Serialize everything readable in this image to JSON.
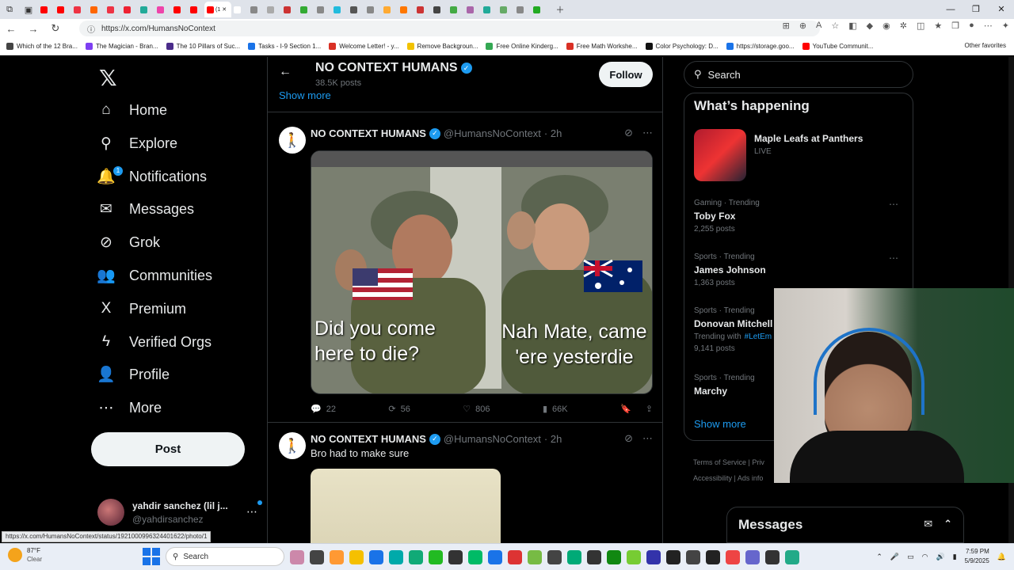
{
  "browser": {
    "active_tab_label": "(1",
    "tab_count_visible": 30,
    "url": "https://x.com/HumansNoContext",
    "status_url": "https://x.com/HumansNoContext/status/1921000996324401622/photo/1",
    "window_controls": [
      "—",
      "❐",
      "✕"
    ],
    "bookmarks": [
      {
        "label": "Which of the 12 Bra...",
        "color": "#444444"
      },
      {
        "label": "The Magician - Bran...",
        "color": "#7e3ff2"
      },
      {
        "label": "The 10 Pillars of Suc...",
        "color": "#4b2c8a"
      },
      {
        "label": "Tasks - I-9 Section 1...",
        "color": "#1a73e8"
      },
      {
        "label": "Welcome Letter! - y...",
        "color": "#d93025"
      },
      {
        "label": "Remove Backgroun...",
        "color": "#f2c200"
      },
      {
        "label": "Free Online Kinderg...",
        "color": "#34a853"
      },
      {
        "label": "Free Math Workshe...",
        "color": "#d93025"
      },
      {
        "label": "Color Psychology: D...",
        "color": "#111111"
      },
      {
        "label": "https://storage.goo...",
        "color": "#1a73e8"
      },
      {
        "label": "YouTube Communit...",
        "color": "#ff0000"
      }
    ],
    "other_favorites": "Other favorites"
  },
  "nav": {
    "items": [
      {
        "label": "Home",
        "icon": "⌂"
      },
      {
        "label": "Explore",
        "icon": "⚲"
      },
      {
        "label": "Notifications",
        "icon": "🔔",
        "badge": "1"
      },
      {
        "label": "Messages",
        "icon": "✉"
      },
      {
        "label": "Grok",
        "icon": "⊘"
      },
      {
        "label": "Communities",
        "icon": "👥"
      },
      {
        "label": "Premium",
        "icon": "X"
      },
      {
        "label": "Verified Orgs",
        "icon": "ϟ"
      },
      {
        "label": "Profile",
        "icon": "👤"
      },
      {
        "label": "More",
        "icon": "⋯"
      }
    ],
    "post_label": "Post",
    "account": {
      "name": "yahdir sanchez (lil j...",
      "handle": "@yahdirsanchez"
    }
  },
  "profile_header": {
    "title": "NO CONTEXT HUMANS",
    "posts": "38.5K posts",
    "show_more": "Show more",
    "follow_label": "Follow"
  },
  "tweets": [
    {
      "name": "NO CONTEXT HUMANS",
      "handle": "@HumansNoContext",
      "time": "· 2h",
      "text": "",
      "caption_left": "Did you come here to die?",
      "caption_right": "Nah Mate, came 'ere yesterdie",
      "replies": "22",
      "reposts": "56",
      "likes": "806",
      "views": "66K"
    },
    {
      "name": "NO CONTEXT HUMANS",
      "handle": "@HumansNoContext",
      "time": "· 2h",
      "text": "Bro had to make sure"
    }
  ],
  "right": {
    "search_placeholder": "Search",
    "trends_title": "What’s happening",
    "event": {
      "name": "Maple Leafs at Panthers",
      "status": "LIVE"
    },
    "trends": [
      {
        "category": "Gaming · Trending",
        "name": "Toby Fox",
        "posts": "2,255 posts"
      },
      {
        "category": "Sports · Trending",
        "name": "James Johnson",
        "posts": "1,363 posts"
      },
      {
        "category": "Sports · Trending",
        "name": "Donovan Mitchell",
        "with_label": "Trending with",
        "with_tag": "#LetEm",
        "posts": "9,141 posts"
      },
      {
        "category": "Sports · Trending",
        "name": "Marchy",
        "posts": ""
      }
    ],
    "show_more": "Show more",
    "footer": [
      "Terms of Service",
      "|",
      "Priv",
      "Accessibility",
      "|",
      "Ads info"
    ],
    "messages_label": "Messages"
  },
  "taskbar": {
    "temp": "87°F",
    "condition": "Clear",
    "search_label": "Search",
    "time": "7:59 PM",
    "date": "5/9/2025"
  }
}
